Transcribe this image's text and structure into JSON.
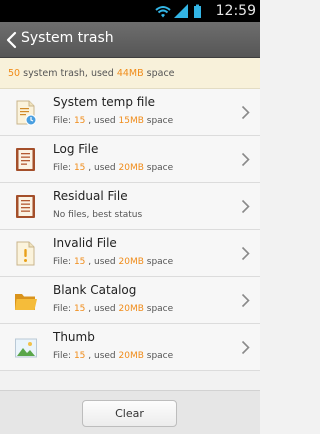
{
  "status_bar": {
    "time": "12:59",
    "icons": [
      "wifi-icon",
      "signal-icon",
      "battery-icon"
    ]
  },
  "header": {
    "title": "System trash",
    "back_icon": "back-chevron-icon"
  },
  "summary": {
    "count": "50",
    "text_middle": " system trash, used ",
    "size": "44MB",
    "text_end": " space"
  },
  "items": [
    {
      "name": "System temp file",
      "icon": "temp-file-icon",
      "file_label": "File: ",
      "count": "15",
      "used_label": " , used ",
      "size": "15MB",
      "space_label": " space"
    },
    {
      "name": "Log File",
      "icon": "log-file-icon",
      "file_label": "File: ",
      "count": "15",
      "used_label": " , used ",
      "size": "20MB",
      "space_label": " space"
    },
    {
      "name": "Residual File",
      "icon": "residual-file-icon",
      "status": "No files, best status"
    },
    {
      "name": "Invalid File",
      "icon": "invalid-file-icon",
      "file_label": "File: ",
      "count": "15",
      "used_label": " , used ",
      "size": "20MB",
      "space_label": " space"
    },
    {
      "name": "Blank Catalog",
      "icon": "folder-icon",
      "file_label": "File: ",
      "count": "15",
      "used_label": " , used ",
      "size": "20MB",
      "space_label": " space"
    },
    {
      "name": "Thumb",
      "icon": "image-thumbnail-icon",
      "file_label": "File: ",
      "count": "15",
      "used_label": " , used ",
      "size": "20MB",
      "space_label": " space"
    }
  ],
  "footer": {
    "clear_label": "Clear"
  },
  "colors": {
    "accent": "#f08c1a",
    "title_bar": "#5f5f5f",
    "summary_bg": "#f8f1da"
  }
}
